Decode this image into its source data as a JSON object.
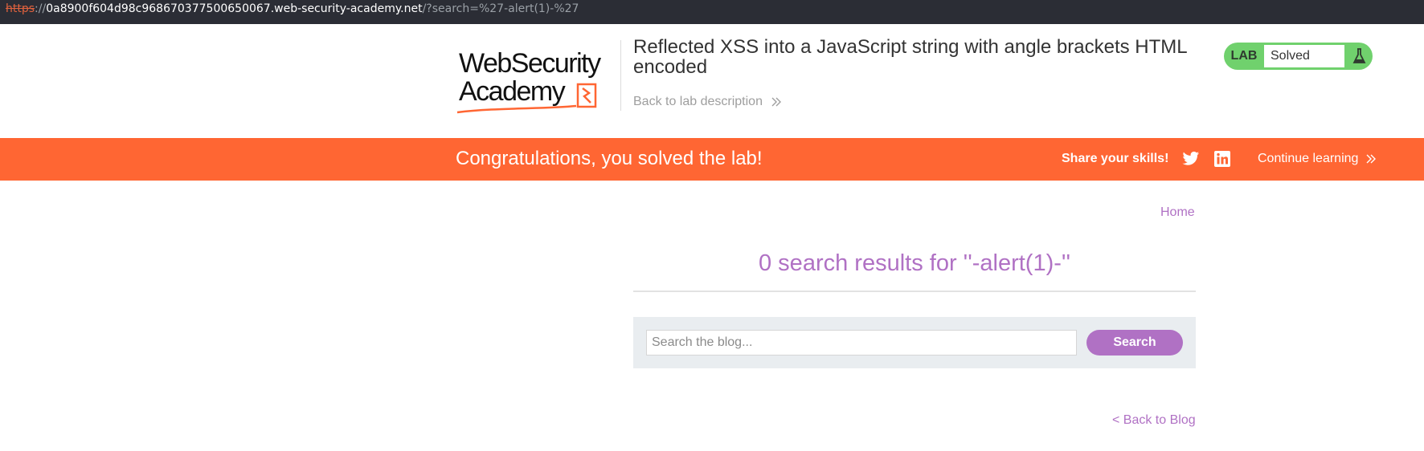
{
  "browser": {
    "url_scheme": "https",
    "url_sep": "://",
    "url_host": "0a8900f604d98c968670377500650067.web-security-academy.net",
    "url_path": "/?search=%27-alert(1)-%27"
  },
  "header": {
    "logo_line1": "WebSecurity",
    "logo_line2": "Academy",
    "lab_title": "Reflected XSS into a JavaScript string with angle brackets HTML encoded",
    "back_link": "Back to lab description",
    "lab_badge_label": "LAB",
    "lab_status": "Solved",
    "flask_icon": "flask-icon",
    "badge_color": "#70d16d"
  },
  "banner": {
    "message": "Congratulations, you solved the lab!",
    "share_label": "Share your skills!",
    "twitter_icon": "twitter-icon",
    "linkedin_icon": "linkedin-icon",
    "continue_label": "Continue learning",
    "color": "#ff6633"
  },
  "main": {
    "home_link": "Home",
    "results_heading": "0 search results for ''-alert(1)-''",
    "search_placeholder": "Search the blog...",
    "search_button": "Search",
    "back_to_blog": "< Back to Blog",
    "accent_color": "#b071c4"
  }
}
